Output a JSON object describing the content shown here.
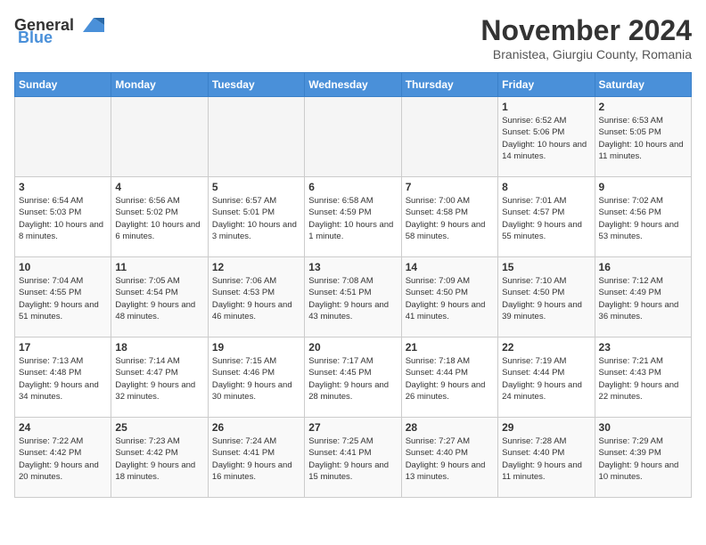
{
  "logo": {
    "general": "General",
    "blue": "Blue"
  },
  "title": "November 2024",
  "location": "Branistea, Giurgiu County, Romania",
  "days_of_week": [
    "Sunday",
    "Monday",
    "Tuesday",
    "Wednesday",
    "Thursday",
    "Friday",
    "Saturday"
  ],
  "weeks": [
    [
      {
        "day": "",
        "info": ""
      },
      {
        "day": "",
        "info": ""
      },
      {
        "day": "",
        "info": ""
      },
      {
        "day": "",
        "info": ""
      },
      {
        "day": "",
        "info": ""
      },
      {
        "day": "1",
        "info": "Sunrise: 6:52 AM\nSunset: 5:06 PM\nDaylight: 10 hours and 14 minutes."
      },
      {
        "day": "2",
        "info": "Sunrise: 6:53 AM\nSunset: 5:05 PM\nDaylight: 10 hours and 11 minutes."
      }
    ],
    [
      {
        "day": "3",
        "info": "Sunrise: 6:54 AM\nSunset: 5:03 PM\nDaylight: 10 hours and 8 minutes."
      },
      {
        "day": "4",
        "info": "Sunrise: 6:56 AM\nSunset: 5:02 PM\nDaylight: 10 hours and 6 minutes."
      },
      {
        "day": "5",
        "info": "Sunrise: 6:57 AM\nSunset: 5:01 PM\nDaylight: 10 hours and 3 minutes."
      },
      {
        "day": "6",
        "info": "Sunrise: 6:58 AM\nSunset: 4:59 PM\nDaylight: 10 hours and 1 minute."
      },
      {
        "day": "7",
        "info": "Sunrise: 7:00 AM\nSunset: 4:58 PM\nDaylight: 9 hours and 58 minutes."
      },
      {
        "day": "8",
        "info": "Sunrise: 7:01 AM\nSunset: 4:57 PM\nDaylight: 9 hours and 55 minutes."
      },
      {
        "day": "9",
        "info": "Sunrise: 7:02 AM\nSunset: 4:56 PM\nDaylight: 9 hours and 53 minutes."
      }
    ],
    [
      {
        "day": "10",
        "info": "Sunrise: 7:04 AM\nSunset: 4:55 PM\nDaylight: 9 hours and 51 minutes."
      },
      {
        "day": "11",
        "info": "Sunrise: 7:05 AM\nSunset: 4:54 PM\nDaylight: 9 hours and 48 minutes."
      },
      {
        "day": "12",
        "info": "Sunrise: 7:06 AM\nSunset: 4:53 PM\nDaylight: 9 hours and 46 minutes."
      },
      {
        "day": "13",
        "info": "Sunrise: 7:08 AM\nSunset: 4:51 PM\nDaylight: 9 hours and 43 minutes."
      },
      {
        "day": "14",
        "info": "Sunrise: 7:09 AM\nSunset: 4:50 PM\nDaylight: 9 hours and 41 minutes."
      },
      {
        "day": "15",
        "info": "Sunrise: 7:10 AM\nSunset: 4:50 PM\nDaylight: 9 hours and 39 minutes."
      },
      {
        "day": "16",
        "info": "Sunrise: 7:12 AM\nSunset: 4:49 PM\nDaylight: 9 hours and 36 minutes."
      }
    ],
    [
      {
        "day": "17",
        "info": "Sunrise: 7:13 AM\nSunset: 4:48 PM\nDaylight: 9 hours and 34 minutes."
      },
      {
        "day": "18",
        "info": "Sunrise: 7:14 AM\nSunset: 4:47 PM\nDaylight: 9 hours and 32 minutes."
      },
      {
        "day": "19",
        "info": "Sunrise: 7:15 AM\nSunset: 4:46 PM\nDaylight: 9 hours and 30 minutes."
      },
      {
        "day": "20",
        "info": "Sunrise: 7:17 AM\nSunset: 4:45 PM\nDaylight: 9 hours and 28 minutes."
      },
      {
        "day": "21",
        "info": "Sunrise: 7:18 AM\nSunset: 4:44 PM\nDaylight: 9 hours and 26 minutes."
      },
      {
        "day": "22",
        "info": "Sunrise: 7:19 AM\nSunset: 4:44 PM\nDaylight: 9 hours and 24 minutes."
      },
      {
        "day": "23",
        "info": "Sunrise: 7:21 AM\nSunset: 4:43 PM\nDaylight: 9 hours and 22 minutes."
      }
    ],
    [
      {
        "day": "24",
        "info": "Sunrise: 7:22 AM\nSunset: 4:42 PM\nDaylight: 9 hours and 20 minutes."
      },
      {
        "day": "25",
        "info": "Sunrise: 7:23 AM\nSunset: 4:42 PM\nDaylight: 9 hours and 18 minutes."
      },
      {
        "day": "26",
        "info": "Sunrise: 7:24 AM\nSunset: 4:41 PM\nDaylight: 9 hours and 16 minutes."
      },
      {
        "day": "27",
        "info": "Sunrise: 7:25 AM\nSunset: 4:41 PM\nDaylight: 9 hours and 15 minutes."
      },
      {
        "day": "28",
        "info": "Sunrise: 7:27 AM\nSunset: 4:40 PM\nDaylight: 9 hours and 13 minutes."
      },
      {
        "day": "29",
        "info": "Sunrise: 7:28 AM\nSunset: 4:40 PM\nDaylight: 9 hours and 11 minutes."
      },
      {
        "day": "30",
        "info": "Sunrise: 7:29 AM\nSunset: 4:39 PM\nDaylight: 9 hours and 10 minutes."
      }
    ]
  ]
}
